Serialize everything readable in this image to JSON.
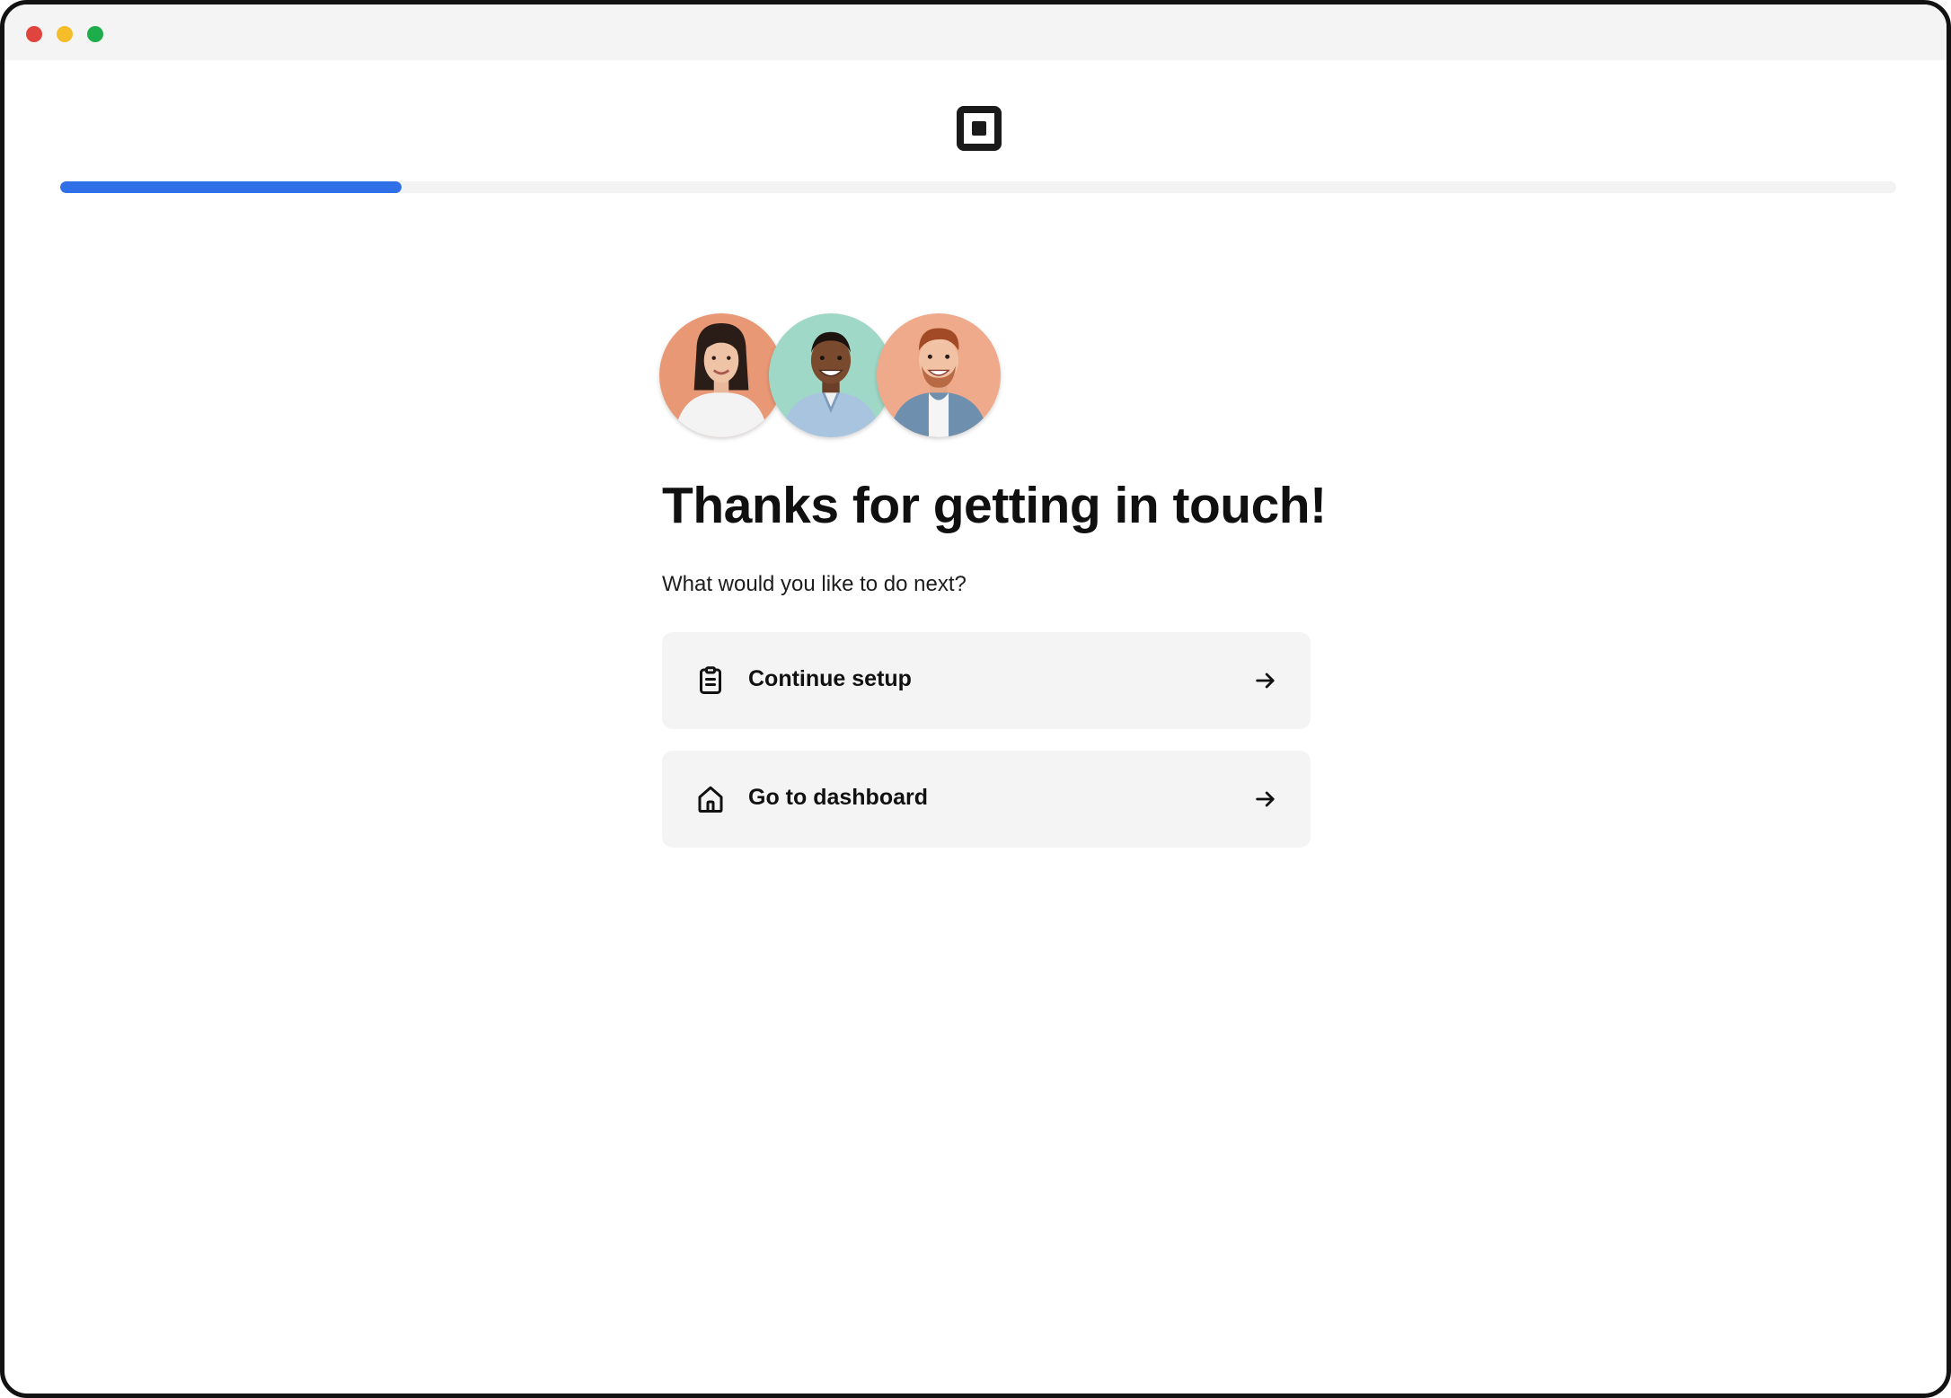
{
  "window": {
    "controls": [
      "close",
      "minimize",
      "maximize"
    ]
  },
  "brand": {
    "icon": "square-logo-icon"
  },
  "progress": {
    "value": 0.186,
    "color": "#2f6fe8"
  },
  "avatars": [
    {
      "name": "person-woman",
      "background": "#e99875"
    },
    {
      "name": "person-man-smiling",
      "background": "#9fd8c6"
    },
    {
      "name": "person-man-redhead",
      "background": "#eeaa8a"
    }
  ],
  "main": {
    "heading": "Thanks for getting in touch!",
    "subtitle": "What would you like to do next?"
  },
  "actions": [
    {
      "label": "Continue setup",
      "icon": "clipboard-icon",
      "trailing_icon": "arrow-right-icon"
    },
    {
      "label": "Go to dashboard",
      "icon": "home-icon",
      "trailing_icon": "arrow-right-icon"
    }
  ]
}
